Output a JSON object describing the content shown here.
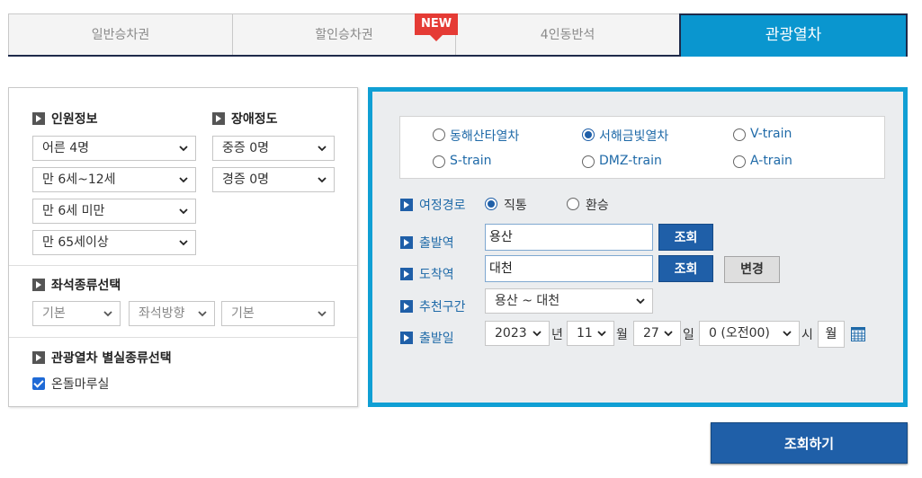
{
  "tabs": [
    {
      "label": "일반승차권"
    },
    {
      "label": "할인승차권"
    },
    {
      "label": "4인동반석"
    },
    {
      "label": "관광열차"
    }
  ],
  "badge_new": "NEW",
  "left": {
    "passenger_title": "인원정보",
    "disability_title": "장애정도",
    "passengers": [
      "어른 4명",
      "만 6세~12세",
      "만 6세 미만",
      "만 65세이상"
    ],
    "disability": [
      "중증 0명",
      "경증 0명"
    ],
    "seat_title": "좌석종류선택",
    "seat_selects": [
      "기본",
      "좌석방향",
      "기본"
    ],
    "room_title": "관광열차 별실종류선택",
    "room_option": "온돌마루실"
  },
  "trains": [
    {
      "label": "동해산타열차",
      "selected": false
    },
    {
      "label": "서해금빛열차",
      "selected": true
    },
    {
      "label": "V-train",
      "selected": false
    },
    {
      "label": "S-train",
      "selected": false
    },
    {
      "label": "DMZ-train",
      "selected": false
    },
    {
      "label": "A-train",
      "selected": false
    }
  ],
  "route": {
    "label": "여정경로",
    "options": [
      "직통",
      "환승"
    ],
    "selected": "직통"
  },
  "departure": {
    "label": "출발역",
    "value": "용산",
    "search_btn": "조회"
  },
  "arrival": {
    "label": "도착역",
    "value": "대천",
    "search_btn": "조회",
    "change_btn": "변경"
  },
  "recommend": {
    "label": "추천구간",
    "value": "용산 ~ 대천"
  },
  "date": {
    "label": "출발일",
    "year": "2023",
    "year_unit": "년",
    "month": "11",
    "month_unit": "월",
    "day": "27",
    "day_unit": "일",
    "hour": "0 (오전00)",
    "hour_unit": "시",
    "weekday": "월"
  },
  "search_button": "조회하기",
  "colors": {
    "accent": "#0a96cf",
    "button": "#1f5fa8",
    "badge": "#e53b35"
  }
}
